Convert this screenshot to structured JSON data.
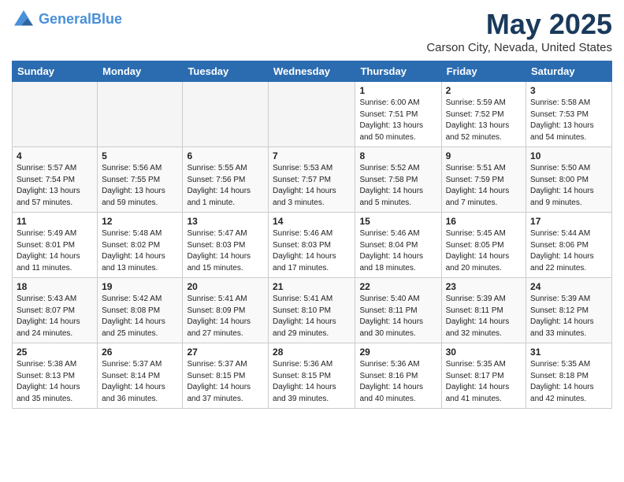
{
  "header": {
    "logo_line1": "General",
    "logo_line2": "Blue",
    "title": "May 2025",
    "subtitle": "Carson City, Nevada, United States"
  },
  "days_of_week": [
    "Sunday",
    "Monday",
    "Tuesday",
    "Wednesday",
    "Thursday",
    "Friday",
    "Saturday"
  ],
  "weeks": [
    [
      {
        "day": "",
        "info": ""
      },
      {
        "day": "",
        "info": ""
      },
      {
        "day": "",
        "info": ""
      },
      {
        "day": "",
        "info": ""
      },
      {
        "day": "1",
        "info": "Sunrise: 6:00 AM\nSunset: 7:51 PM\nDaylight: 13 hours\nand 50 minutes."
      },
      {
        "day": "2",
        "info": "Sunrise: 5:59 AM\nSunset: 7:52 PM\nDaylight: 13 hours\nand 52 minutes."
      },
      {
        "day": "3",
        "info": "Sunrise: 5:58 AM\nSunset: 7:53 PM\nDaylight: 13 hours\nand 54 minutes."
      }
    ],
    [
      {
        "day": "4",
        "info": "Sunrise: 5:57 AM\nSunset: 7:54 PM\nDaylight: 13 hours\nand 57 minutes."
      },
      {
        "day": "5",
        "info": "Sunrise: 5:56 AM\nSunset: 7:55 PM\nDaylight: 13 hours\nand 59 minutes."
      },
      {
        "day": "6",
        "info": "Sunrise: 5:55 AM\nSunset: 7:56 PM\nDaylight: 14 hours\nand 1 minute."
      },
      {
        "day": "7",
        "info": "Sunrise: 5:53 AM\nSunset: 7:57 PM\nDaylight: 14 hours\nand 3 minutes."
      },
      {
        "day": "8",
        "info": "Sunrise: 5:52 AM\nSunset: 7:58 PM\nDaylight: 14 hours\nand 5 minutes."
      },
      {
        "day": "9",
        "info": "Sunrise: 5:51 AM\nSunset: 7:59 PM\nDaylight: 14 hours\nand 7 minutes."
      },
      {
        "day": "10",
        "info": "Sunrise: 5:50 AM\nSunset: 8:00 PM\nDaylight: 14 hours\nand 9 minutes."
      }
    ],
    [
      {
        "day": "11",
        "info": "Sunrise: 5:49 AM\nSunset: 8:01 PM\nDaylight: 14 hours\nand 11 minutes."
      },
      {
        "day": "12",
        "info": "Sunrise: 5:48 AM\nSunset: 8:02 PM\nDaylight: 14 hours\nand 13 minutes."
      },
      {
        "day": "13",
        "info": "Sunrise: 5:47 AM\nSunset: 8:03 PM\nDaylight: 14 hours\nand 15 minutes."
      },
      {
        "day": "14",
        "info": "Sunrise: 5:46 AM\nSunset: 8:03 PM\nDaylight: 14 hours\nand 17 minutes."
      },
      {
        "day": "15",
        "info": "Sunrise: 5:46 AM\nSunset: 8:04 PM\nDaylight: 14 hours\nand 18 minutes."
      },
      {
        "day": "16",
        "info": "Sunrise: 5:45 AM\nSunset: 8:05 PM\nDaylight: 14 hours\nand 20 minutes."
      },
      {
        "day": "17",
        "info": "Sunrise: 5:44 AM\nSunset: 8:06 PM\nDaylight: 14 hours\nand 22 minutes."
      }
    ],
    [
      {
        "day": "18",
        "info": "Sunrise: 5:43 AM\nSunset: 8:07 PM\nDaylight: 14 hours\nand 24 minutes."
      },
      {
        "day": "19",
        "info": "Sunrise: 5:42 AM\nSunset: 8:08 PM\nDaylight: 14 hours\nand 25 minutes."
      },
      {
        "day": "20",
        "info": "Sunrise: 5:41 AM\nSunset: 8:09 PM\nDaylight: 14 hours\nand 27 minutes."
      },
      {
        "day": "21",
        "info": "Sunrise: 5:41 AM\nSunset: 8:10 PM\nDaylight: 14 hours\nand 29 minutes."
      },
      {
        "day": "22",
        "info": "Sunrise: 5:40 AM\nSunset: 8:11 PM\nDaylight: 14 hours\nand 30 minutes."
      },
      {
        "day": "23",
        "info": "Sunrise: 5:39 AM\nSunset: 8:11 PM\nDaylight: 14 hours\nand 32 minutes."
      },
      {
        "day": "24",
        "info": "Sunrise: 5:39 AM\nSunset: 8:12 PM\nDaylight: 14 hours\nand 33 minutes."
      }
    ],
    [
      {
        "day": "25",
        "info": "Sunrise: 5:38 AM\nSunset: 8:13 PM\nDaylight: 14 hours\nand 35 minutes."
      },
      {
        "day": "26",
        "info": "Sunrise: 5:37 AM\nSunset: 8:14 PM\nDaylight: 14 hours\nand 36 minutes."
      },
      {
        "day": "27",
        "info": "Sunrise: 5:37 AM\nSunset: 8:15 PM\nDaylight: 14 hours\nand 37 minutes."
      },
      {
        "day": "28",
        "info": "Sunrise: 5:36 AM\nSunset: 8:15 PM\nDaylight: 14 hours\nand 39 minutes."
      },
      {
        "day": "29",
        "info": "Sunrise: 5:36 AM\nSunset: 8:16 PM\nDaylight: 14 hours\nand 40 minutes."
      },
      {
        "day": "30",
        "info": "Sunrise: 5:35 AM\nSunset: 8:17 PM\nDaylight: 14 hours\nand 41 minutes."
      },
      {
        "day": "31",
        "info": "Sunrise: 5:35 AM\nSunset: 8:18 PM\nDaylight: 14 hours\nand 42 minutes."
      }
    ]
  ]
}
